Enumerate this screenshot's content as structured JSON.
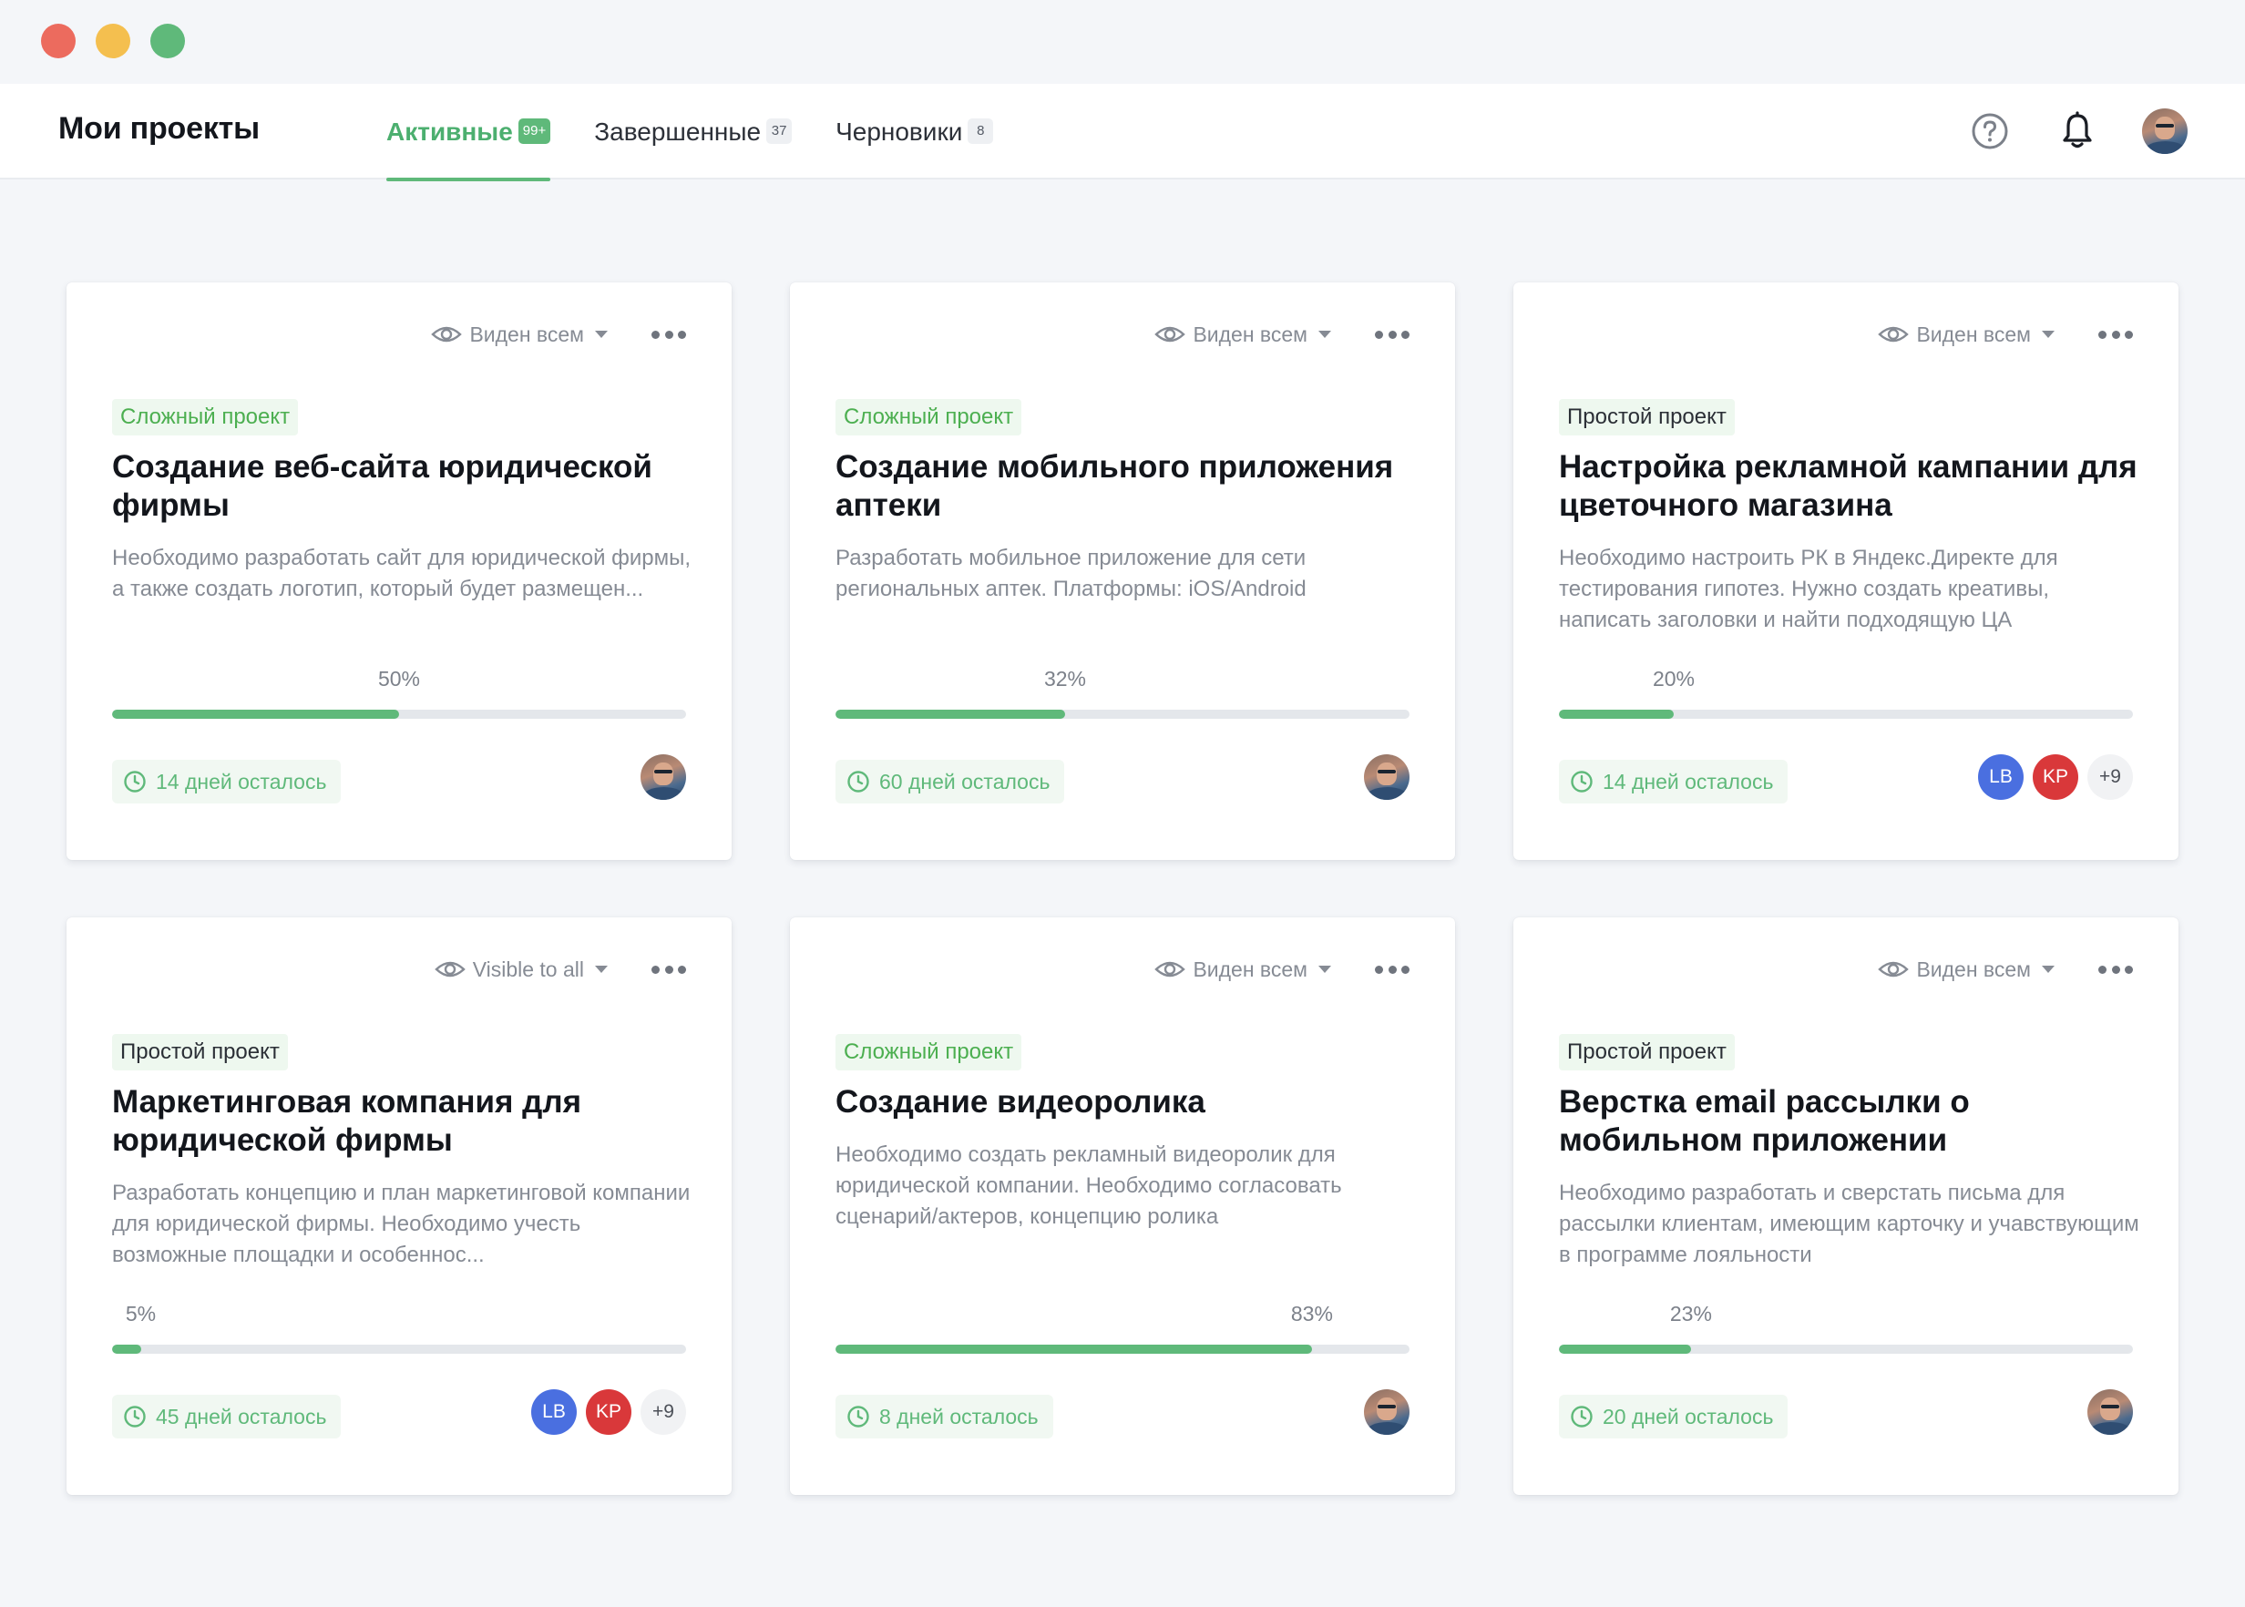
{
  "window": {
    "controls": [
      "close",
      "minimize",
      "zoom"
    ]
  },
  "header": {
    "title": "Мои проекты",
    "tabs": [
      {
        "label": "Активные",
        "count": "99+",
        "active": true
      },
      {
        "label": "Завершенные",
        "count": "37",
        "active": false
      },
      {
        "label": "Черновики",
        "count": "8",
        "active": false
      }
    ],
    "icons": [
      "help-icon",
      "bell-icon",
      "user-avatar"
    ]
  },
  "colors": {
    "accent": "#5fb97a",
    "avatar_lb": "#4a6fe0",
    "avatar_kp": "#d9383a"
  },
  "cards": [
    {
      "visibility": "Виден всем",
      "badge": "Сложный проект",
      "kind": "complex",
      "title": "Создание веб-сайта юридической фирмы",
      "description": "Необходимо разработать сайт для юридической фирмы, а также создать логотип, который будет размещен...",
      "progress": 50,
      "progress_label": "50%",
      "deadline": "14 дней осталось",
      "members": {
        "photo": true,
        "initials": [],
        "extra": ""
      }
    },
    {
      "visibility": "Виден всем",
      "badge": "Сложный проект",
      "kind": "complex",
      "title": "Создание мобильного приложения аптеки",
      "description": "Разработать мобильное приложение для сети региональных аптек. Платформы: iOS/Android",
      "progress": 40,
      "progress_label": "32%",
      "deadline": "60 дней осталось",
      "members": {
        "photo": true,
        "initials": [],
        "extra": ""
      }
    },
    {
      "visibility": "Виден всем",
      "badge": "Простой проект",
      "kind": "simple",
      "title": "Настройка рекламной кампании для цветочного магазина",
      "description": "Необходимо настроить РК в Яндекс.Директе для тестирования гипотез. Нужно создать креативы, написать заголовки и найти подходящую ЦА",
      "progress": 20,
      "progress_label": "20%",
      "deadline": "14 дней осталось",
      "members": {
        "photo": false,
        "initials": [
          "LB",
          "KP"
        ],
        "extra": "+9"
      }
    },
    {
      "visibility": "Visible to all",
      "badge": "Простой проект",
      "kind": "simple",
      "title": "Маркетинговая компания для юридической фирмы",
      "description": "Разработать концепцию и план маркетинговой компании для юридической фирмы. Необходимо учесть возможные площадки и особеннос...",
      "progress": 5,
      "progress_label": "5%",
      "deadline": "45 дней осталось",
      "members": {
        "photo": false,
        "initials": [
          "LB",
          "KP"
        ],
        "extra": "+9"
      }
    },
    {
      "visibility": "Виден всем",
      "badge": "Сложный проект",
      "kind": "complex",
      "title": "Создание видеоролика",
      "description": "Необходимо создать рекламный видеоролик для юридической компании. Необходимо согласовать сценарий/актеров, концепцию ролика",
      "progress": 83,
      "progress_label": "83%",
      "deadline": "8 дней осталось",
      "members": {
        "photo": true,
        "initials": [],
        "extra": ""
      }
    },
    {
      "visibility": "Виден всем",
      "badge": "Простой проект",
      "kind": "simple",
      "title": "Верстка email рассылки о мобильном приложении",
      "description": "Необходимо разработать и сверстать письма для рассылки клиентам, имеющим карточку и учавствующим в программе лояльности",
      "progress": 23,
      "progress_label": "23%",
      "deadline": "20 дней осталось",
      "members": {
        "photo": true,
        "initials": [],
        "extra": ""
      }
    }
  ]
}
